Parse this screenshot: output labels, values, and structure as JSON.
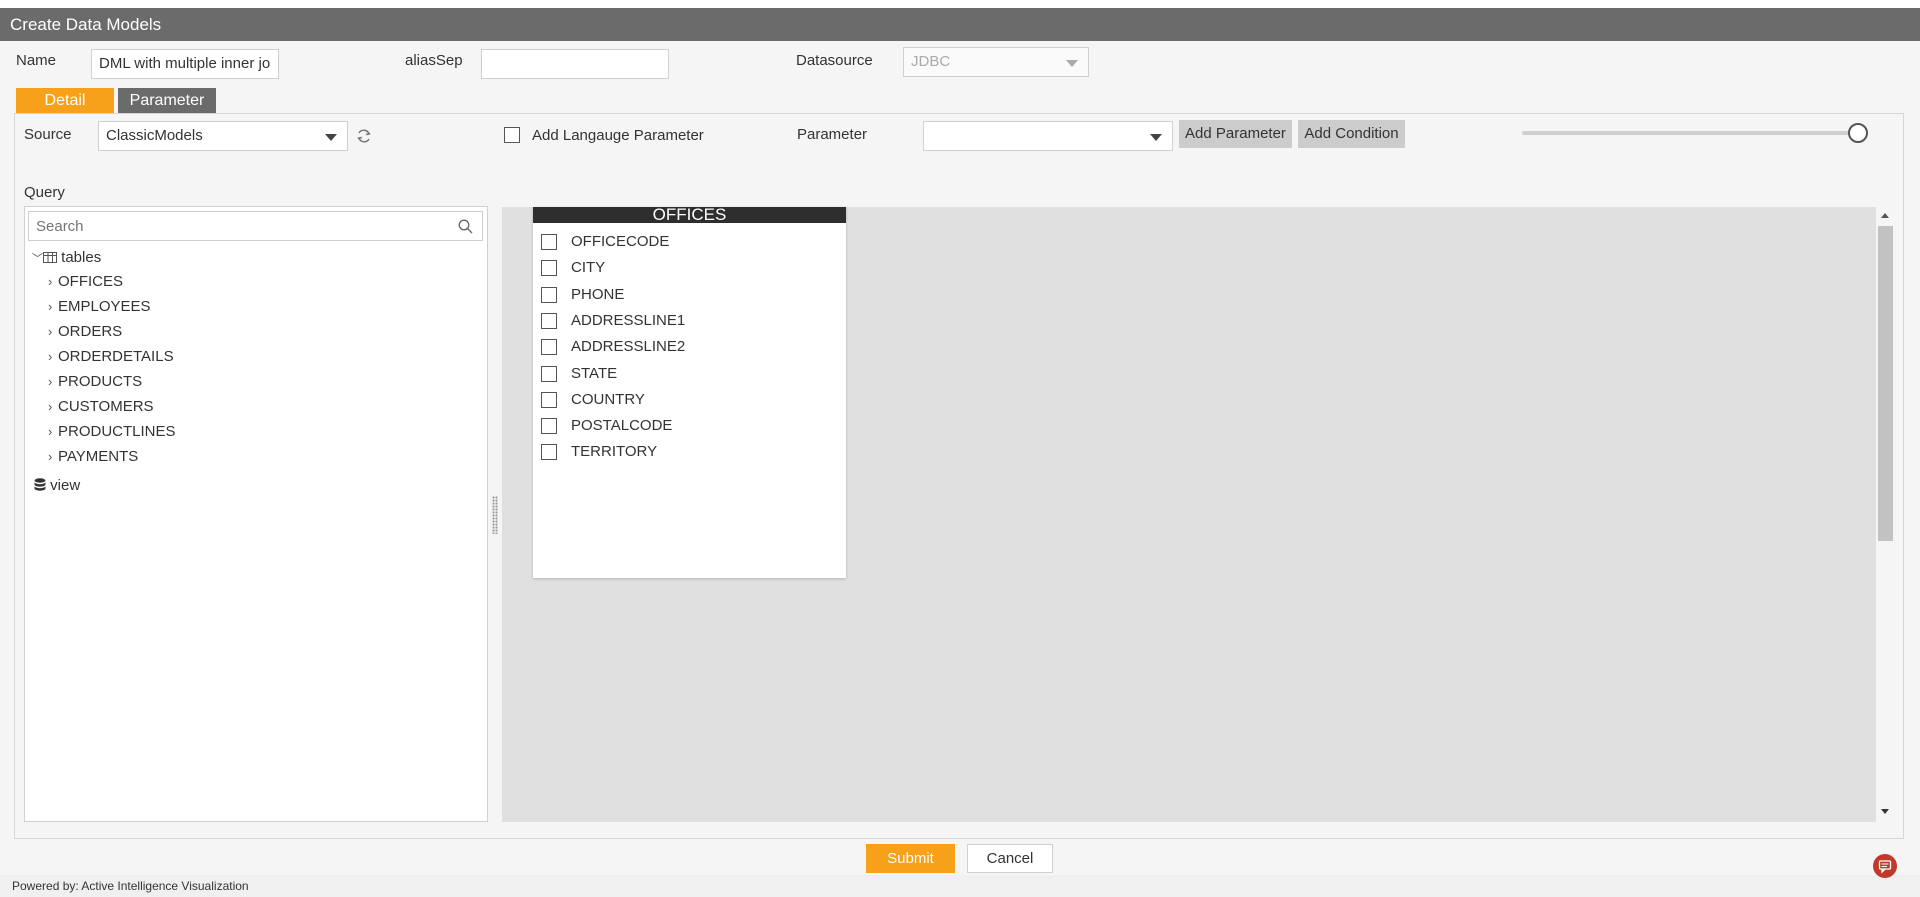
{
  "window": {
    "title": "Create Data Models"
  },
  "form": {
    "name_label": "Name",
    "name_value": "DML with multiple inner jo",
    "aliassep_label": "aliasSep",
    "aliassep_value": "",
    "datasource_label": "Datasource",
    "datasource_value": "JDBC"
  },
  "tabs": [
    {
      "label": "Detail",
      "active": true,
      "color": "#f7a11a"
    },
    {
      "label": "Parameter",
      "active": false,
      "color": "#6b6b6b"
    }
  ],
  "detail": {
    "source_label": "Source",
    "source_value": "ClassicModels",
    "add_language_parameter_label": "Add Langauge Parameter",
    "parameter_label": "Parameter",
    "parameter_value": "",
    "add_parameter_label": "Add Parameter",
    "add_condition_label": "Add Condition",
    "zoom_level": 1.0,
    "query_label": "Query"
  },
  "tree": {
    "search_placeholder": "Search",
    "root_label": "tables",
    "tables": [
      "OFFICES",
      "EMPLOYEES",
      "ORDERS",
      "ORDERDETAILS",
      "PRODUCTS",
      "CUSTOMERS",
      "PRODUCTLINES",
      "PAYMENTS"
    ],
    "view_label": "view"
  },
  "canvas": {
    "table_card": {
      "title": "OFFICES",
      "columns": [
        "OFFICECODE",
        "CITY",
        "PHONE",
        "ADDRESSLINE1",
        "ADDRESSLINE2",
        "STATE",
        "COUNTRY",
        "POSTALCODE",
        "TERRITORY"
      ]
    }
  },
  "actions": {
    "submit_label": "Submit",
    "cancel_label": "Cancel"
  },
  "footer": {
    "powered_by": "Powered by: Active Intelligence Visualization"
  },
  "colors": {
    "accent": "#f7a11a",
    "titlebar": "#6b6b6b",
    "canvas": "#e0e0e0"
  },
  "icons": {
    "refresh": "refresh-icon",
    "search": "search-icon",
    "table": "table-icon",
    "database": "database-icon",
    "chat": "chat-icon"
  }
}
